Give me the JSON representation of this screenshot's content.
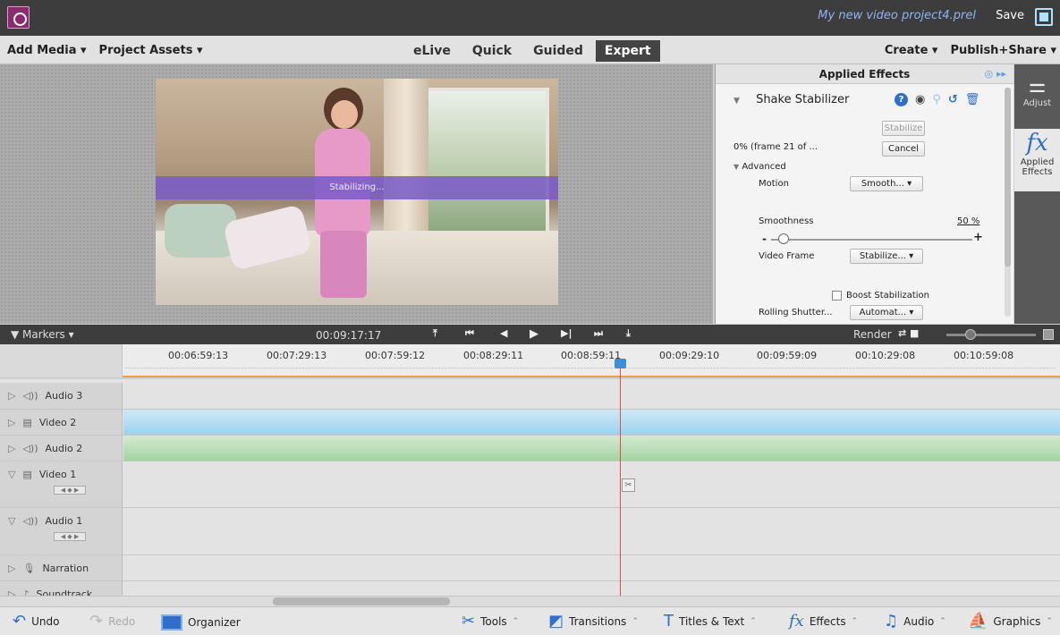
{
  "window": {
    "project_name": "My new video project4.prel",
    "save_label": "Save"
  },
  "menu": {
    "add_media": "Add Media ▾",
    "project_assets": "Project Assets ▾",
    "create": "Create ▾",
    "publish_share": "Publish+Share ▾"
  },
  "modes": [
    "eLive",
    "Quick",
    "Guided",
    "Expert"
  ],
  "monitor": {
    "overlay_text": "Stabilizing..."
  },
  "effects_panel": {
    "title": "Applied Effects",
    "effect_name": "Shake Stabilizer",
    "stabilize_btn": "Stabilize",
    "progress_text": "0% (frame 21 of ...",
    "cancel_btn": "Cancel",
    "advanced_label": "Advanced",
    "motion_label": "Motion",
    "motion_value": "Smooth... ▾",
    "smoothness_label": "Smoothness",
    "smoothness_value": "50 %",
    "smoothness_fraction": 0.5,
    "minus": "-",
    "plus": "+",
    "video_frame_label": "Video Frame",
    "video_frame_value": "Stabilize... ▾",
    "boost_label": "Boost Stabilization",
    "rolling_label": "Rolling Shutter...",
    "rolling_value": "Automat... ▾"
  },
  "rail": {
    "adjust_label": "Adjust",
    "applied_line1": "Applied",
    "applied_line2": "Effects"
  },
  "transport": {
    "markers": "▼ Markers ▾",
    "current_time": "00:09:17:17",
    "render": "Render"
  },
  "ruler": [
    "00:06:59:13",
    "00:07:29:13",
    "00:07:59:12",
    "00:08:29:11",
    "00:08:59:11",
    "00:09:29:10",
    "00:09:59:09",
    "00:10:29:08",
    "00:10:59:08"
  ],
  "tracks": {
    "audio3": "Audio 3",
    "video2": "Video 2",
    "audio2": "Audio 2",
    "video1": "Video 1",
    "audio1": "Audio 1",
    "narration": "Narration",
    "soundtrack": "Soundtrack"
  },
  "bottombar": {
    "undo": "Undo",
    "redo": "Redo",
    "organizer": "Organizer",
    "tools": "Tools",
    "transitions": "Transitions",
    "titles": "Titles & Text",
    "effects": "Effects",
    "audio": "Audio",
    "graphics": "Graphics"
  }
}
